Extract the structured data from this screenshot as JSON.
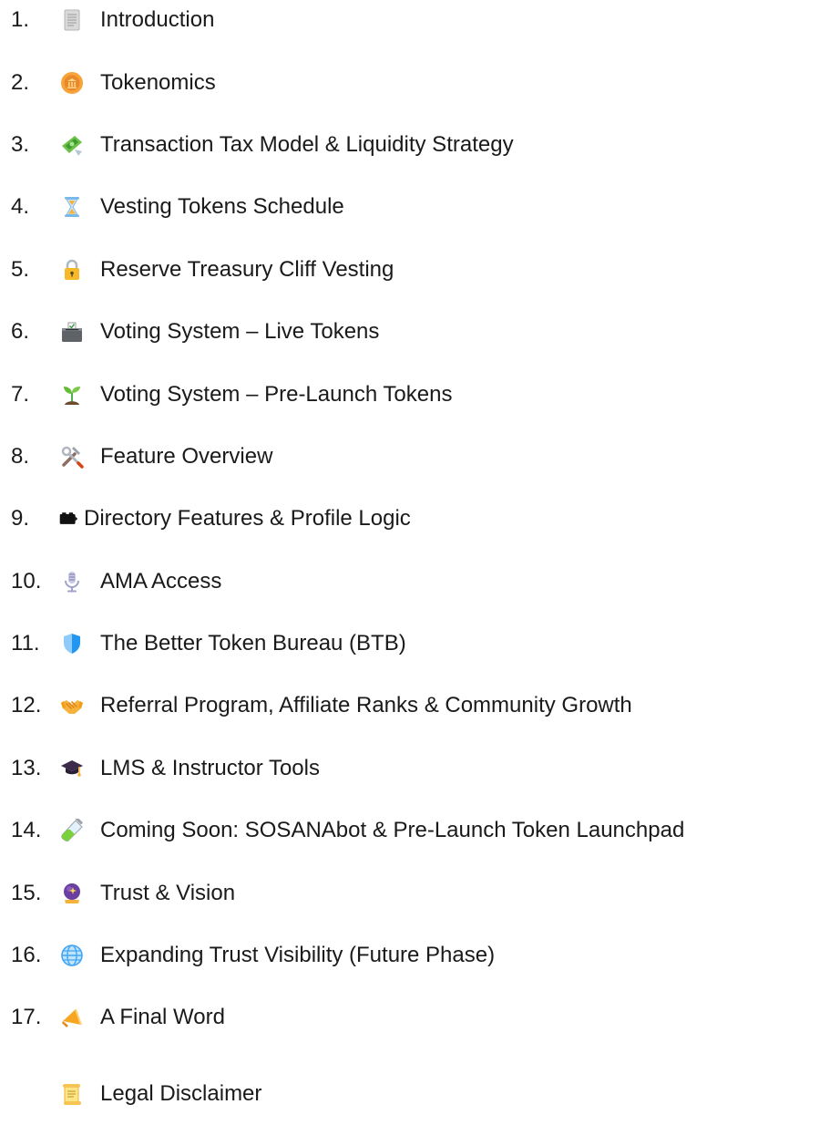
{
  "toc": {
    "items": [
      {
        "number": "1.",
        "icon": "page-icon",
        "label": "Introduction"
      },
      {
        "number": "2.",
        "icon": "coin-bank-icon",
        "label": "Tokenomics"
      },
      {
        "number": "3.",
        "icon": "money-wings-icon",
        "label": "Transaction Tax Model & Liquidity Strategy"
      },
      {
        "number": "4.",
        "icon": "hourglass-icon",
        "label": "Vesting Tokens Schedule"
      },
      {
        "number": "5.",
        "icon": "lock-icon",
        "label": "Reserve Treasury Cliff Vesting"
      },
      {
        "number": "6.",
        "icon": "ballot-box-icon",
        "label": "Voting System – Live Tokens"
      },
      {
        "number": "7.",
        "icon": "seedling-icon",
        "label": "Voting System – Pre-Launch Tokens"
      },
      {
        "number": "8.",
        "icon": "tools-icon",
        "label": "Feature Overview"
      },
      {
        "number": "9.",
        "icon": "card-index-icon",
        "label": "Directory Features & Profile Logic"
      },
      {
        "number": "10.",
        "icon": "microphone-icon",
        "label": "AMA Access"
      },
      {
        "number": "11.",
        "icon": "shield-icon",
        "label": "The Better Token Bureau (BTB)"
      },
      {
        "number": "12.",
        "icon": "handshake-icon",
        "label": "Referral Program, Affiliate Ranks & Community Growth"
      },
      {
        "number": "13.",
        "icon": "graduation-cap-icon",
        "label": "LMS & Instructor Tools"
      },
      {
        "number": "14.",
        "icon": "test-tube-icon",
        "label": "Coming Soon: SOSANAbot & Pre-Launch Token Launchpad"
      },
      {
        "number": "15.",
        "icon": "crystal-ball-icon",
        "label": "Trust & Vision"
      },
      {
        "number": "16.",
        "icon": "globe-icon",
        "label": "Expanding Trust Visibility (Future Phase)"
      },
      {
        "number": "17.",
        "icon": "megaphone-icon",
        "label": "A Final Word"
      }
    ],
    "sub_item": {
      "icon": "scroll-icon",
      "label": "Legal Disclaimer"
    }
  }
}
